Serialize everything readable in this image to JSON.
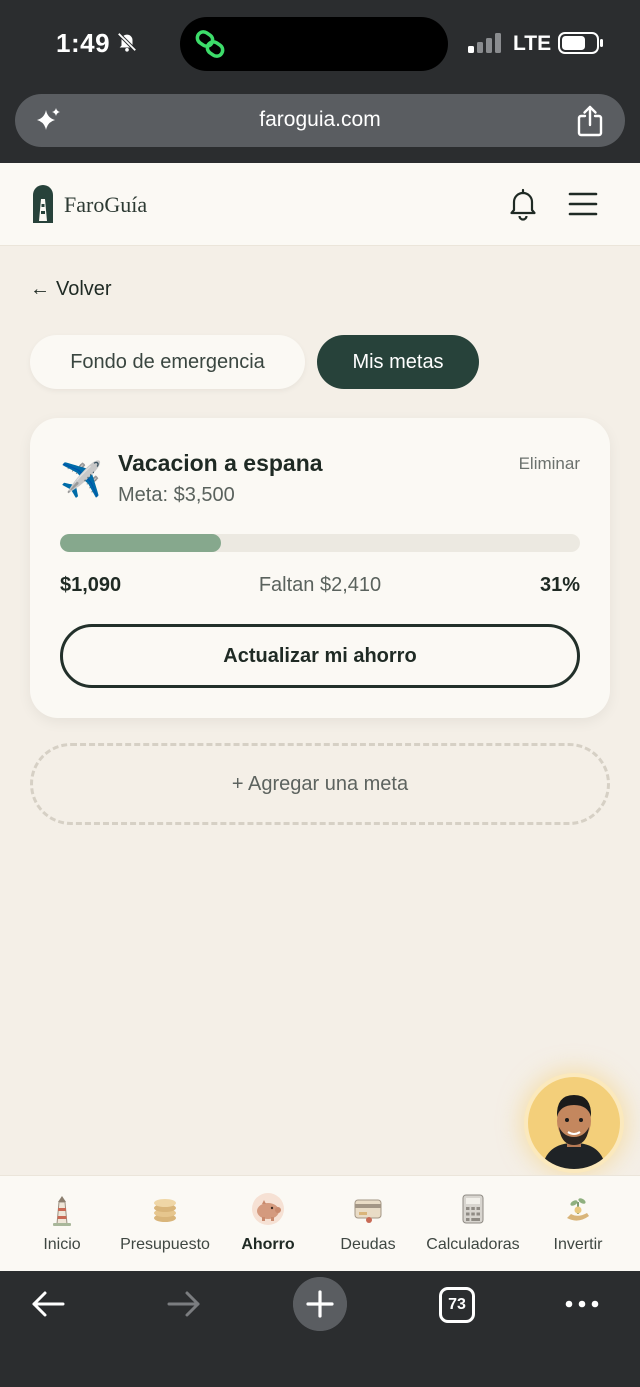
{
  "status_bar": {
    "time": "1:49",
    "network": "LTE"
  },
  "browser": {
    "url": "faroguia.com",
    "tab_count": "73"
  },
  "header": {
    "brand": "FaroGuía"
  },
  "back": {
    "label": "Volver"
  },
  "tabs": [
    {
      "label": "Fondo de emergencia",
      "active": false
    },
    {
      "label": "Mis metas",
      "active": true
    }
  ],
  "goal": {
    "icon": "airplane-icon",
    "name": "Vacacion a espana",
    "target": "Meta: $3,500",
    "delete_label": "Eliminar",
    "saved": "$1,090",
    "remaining": "Faltan $2,410",
    "percent": "31%",
    "progress": 0.31,
    "update_label": "Actualizar mi ahorro"
  },
  "add_goal": {
    "label": "+ Agregar una meta"
  },
  "bottom_nav": [
    {
      "label": "Inicio",
      "icon": "lighthouse-icon"
    },
    {
      "label": "Presupuesto",
      "icon": "coins-icon"
    },
    {
      "label": "Ahorro",
      "icon": "piggy-bank-icon",
      "active": true
    },
    {
      "label": "Deudas",
      "icon": "card-icon"
    },
    {
      "label": "Calculadoras",
      "icon": "calculator-icon"
    },
    {
      "label": "Invertir",
      "icon": "money-plant-icon"
    }
  ],
  "colors": {
    "accent": "#27423a",
    "progress_fill": "#86a88d",
    "background": "#f4efe7"
  }
}
